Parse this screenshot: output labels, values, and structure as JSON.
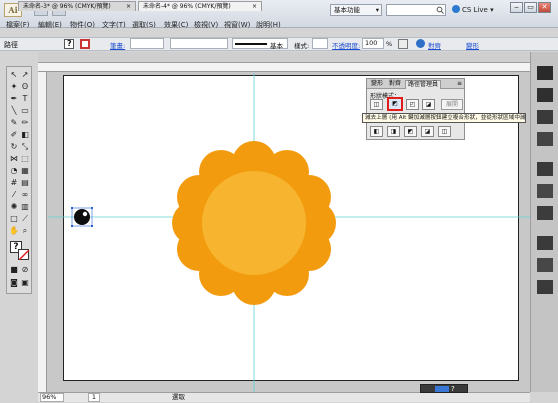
{
  "app": {
    "logo": "Ai",
    "workspace": "基本功能",
    "cs_live": "CS Live",
    "window_buttons": [
      "‒",
      "▭",
      "✕"
    ]
  },
  "menu": [
    "檔案(F)",
    "編輯(E)",
    "物件(O)",
    "文字(T)",
    "選取(S)",
    "效果(C)",
    "檢視(V)",
    "視窗(W)",
    "說明(H)"
  ],
  "control_bar": {
    "label": "路徑",
    "stroke_label": "筆畫:",
    "brush_label": "基本",
    "style_label": "樣式:",
    "opacity_label": "不透明度:",
    "opacity_value": "100",
    "opacity_unit": "%",
    "align_link": "對齊",
    "transform_link": "變形"
  },
  "tabs": [
    {
      "label": "未命名-3* @ 96% (CMYK/預覽)",
      "close": "×"
    },
    {
      "label": "未命名-4* @ 96% (CMYK/預覽)",
      "close": "×"
    }
  ],
  "pathfinder": {
    "tabs": [
      "變形",
      "對齊",
      "路徑管理員"
    ],
    "shape_modes_label": "形狀模式：",
    "expand_label": "展開",
    "pathfinders_label": "路徑管理員：",
    "tooltip": "減去上層 (用 Alt 鍵加減層按鈕建立複合形狀，並從形狀區域中減去)"
  },
  "status": {
    "zoom": "96%",
    "page": "1",
    "mode": "選取"
  },
  "colors": {
    "flower_outer": "#f29b0f",
    "flower_inner": "#f7b42e",
    "guide": "#5fd3d8",
    "highlight": "#e21b1b"
  }
}
